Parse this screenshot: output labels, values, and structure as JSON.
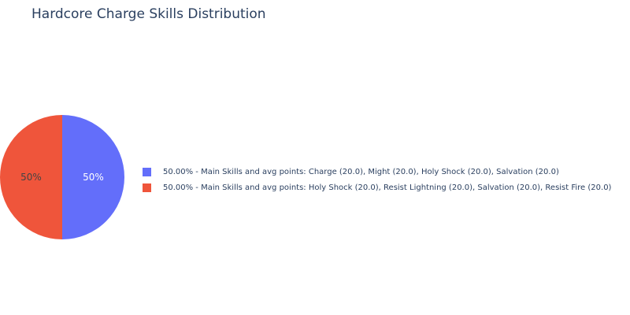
{
  "chart_data": {
    "type": "pie",
    "title": "Hardcore Charge Skills Distribution",
    "slices": [
      {
        "label": "50.00% - Main Skills and avg points: Charge (20.0), Might (20.0), Holy Shock (20.0), Salvation (20.0)",
        "value": 50,
        "text": "50%",
        "color": "#636efa"
      },
      {
        "label": "50.00% - Main Skills and avg points: Holy Shock (20.0), Resist Lightning (20.0), Salvation (20.0), Resist Fire (20.0)",
        "value": 50,
        "text": "50%",
        "color": "#ef553b"
      }
    ],
    "legend_position": "right",
    "slice_label_colors": [
      "#ffffff",
      "#444444"
    ]
  }
}
